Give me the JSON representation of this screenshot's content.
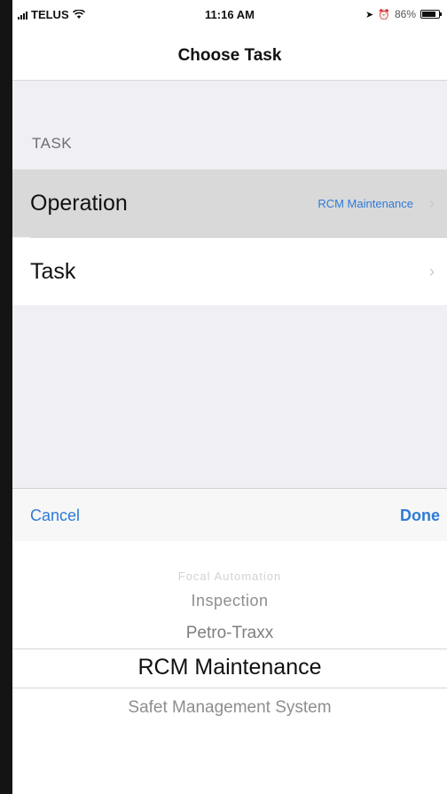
{
  "status_bar": {
    "carrier": "TELUS",
    "time": "11:16 AM",
    "battery": "86%"
  },
  "nav": {
    "title": "Choose Task"
  },
  "section": {
    "header": "TASK"
  },
  "rows": [
    {
      "label": "Operation",
      "value": "RCM Maintenance"
    },
    {
      "label": "Task",
      "value": ""
    }
  ],
  "toolbar": {
    "cancel_label": "Cancel",
    "done_label": "Done"
  },
  "picker": {
    "options": [
      "Focal Automation",
      "Inspection",
      "Petro-Traxx",
      "RCM Maintenance",
      "Safet Management System"
    ],
    "selected": "RCM Maintenance"
  },
  "colors": {
    "accent": "#2e7ad6",
    "background": "#efeff4",
    "selected_row": "#d9d9d9"
  }
}
